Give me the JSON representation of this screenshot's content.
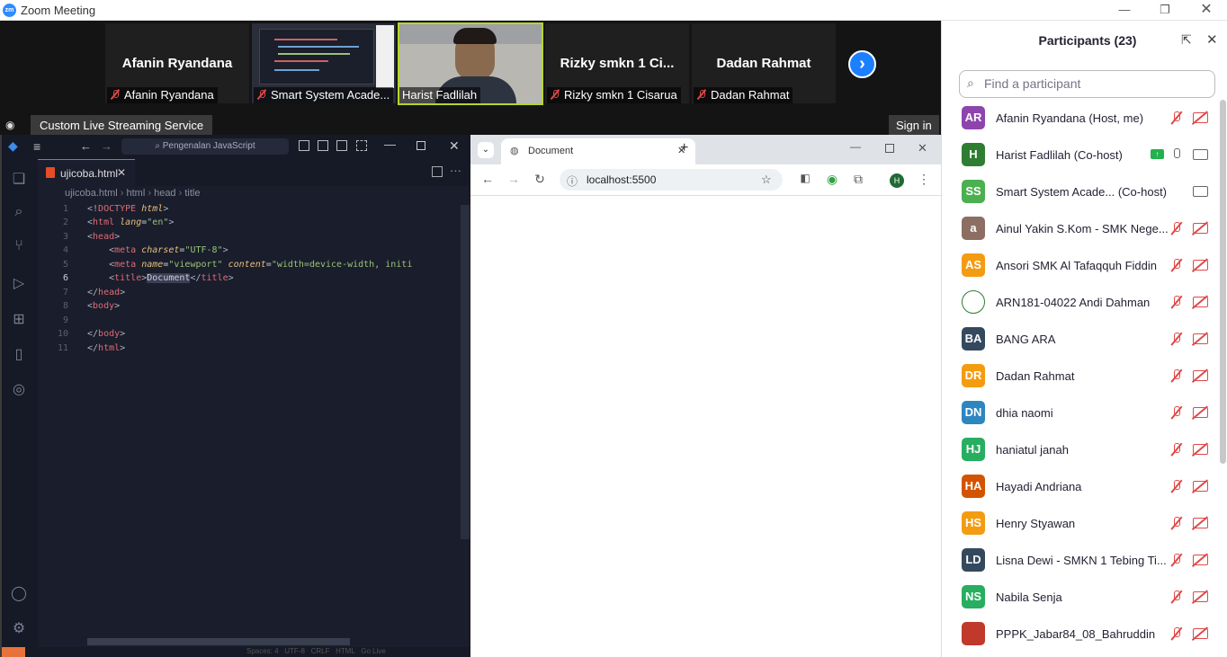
{
  "window": {
    "title": "Zoom Meeting",
    "logo": "zm"
  },
  "strip": {
    "tiles": [
      {
        "big": "Afanin Ryandana",
        "label": "Afanin Ryandana",
        "muted": true
      },
      {
        "big": "",
        "label": "Smart System Acade...",
        "muted": true
      },
      {
        "big": "",
        "label": "Harist Fadlilah",
        "muted": false
      },
      {
        "big": "Rizky smkn 1 Ci...",
        "label": "Rizky smkn 1 Cisarua",
        "muted": true
      },
      {
        "big": "Dadan Rahmat",
        "label": "Dadan Rahmat",
        "muted": true
      }
    ],
    "streaming_label": "Custom Live Streaming Service",
    "sign_in_label": "Sign in"
  },
  "vscode": {
    "search": "Pengenalan JavaScript",
    "tab": "ujicoba.html",
    "breadcrumb": [
      "ujicoba.html",
      "html",
      "head",
      "title"
    ],
    "status": "Spaces: 4   UTF-8   CRLF   HTML   Go Live"
  },
  "chrome": {
    "tab_title": "Document",
    "url": "localhost:5500",
    "profile": "H"
  },
  "participants": {
    "title": "Participants (23)",
    "search_placeholder": "Find a participant",
    "list": [
      {
        "initials": "AR",
        "name": "Afanin Ryandana (Host, me)",
        "color": "#8e44ad"
      },
      {
        "initials": "H",
        "name": "Harist Fadlilah (Co-host)",
        "color": "#2e7d32"
      },
      {
        "initials": "SS",
        "name": "Smart System Acade...  (Co-host)",
        "color": "#4caf50"
      },
      {
        "initials": "a",
        "name": "Ainul Yakin S.Kom - SMK Nege...",
        "color": "#8d6e63"
      },
      {
        "initials": "AS",
        "name": "Ansori SMK Al Tafaqquh Fiddin",
        "color": "#f39c12"
      },
      {
        "initials": "",
        "name": "ARN181-04022 Andi Dahman",
        "color": "#ffffff"
      },
      {
        "initials": "BA",
        "name": "BANG ARA",
        "color": "#34495e"
      },
      {
        "initials": "DR",
        "name": "Dadan Rahmat",
        "color": "#f39c12"
      },
      {
        "initials": "DN",
        "name": "dhia naomi",
        "color": "#2e86c1"
      },
      {
        "initials": "HJ",
        "name": "haniatul janah",
        "color": "#27ae60"
      },
      {
        "initials": "HA",
        "name": "Hayadi Andriana",
        "color": "#d35400"
      },
      {
        "initials": "HS",
        "name": "Henry Styawan",
        "color": "#f39c12"
      },
      {
        "initials": "LD",
        "name": "Lisna Dewi - SMKN 1 Tebing Ti...",
        "color": "#34495e"
      },
      {
        "initials": "NS",
        "name": "Nabila Senja",
        "color": "#27ae60"
      },
      {
        "initials": "",
        "name": "PPPK_Jabar84_08_Bahruddin",
        "color": "#c0392b"
      }
    ]
  }
}
